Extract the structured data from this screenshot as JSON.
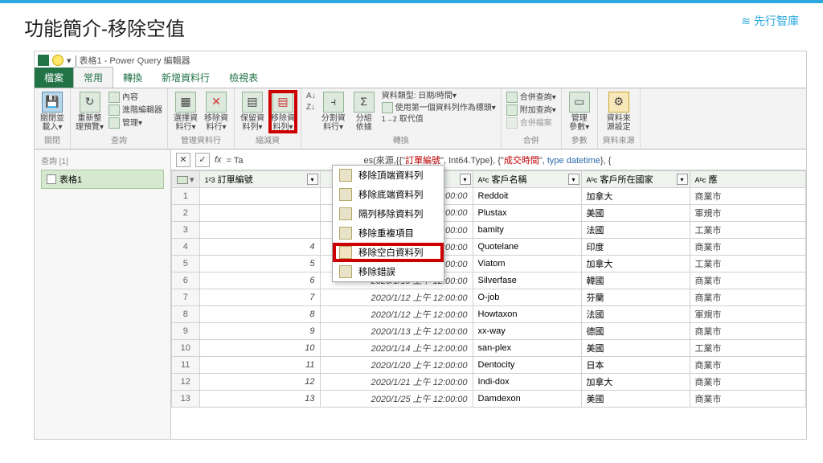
{
  "page": {
    "title": "功能簡介-移除空值",
    "brand": "先行智庫"
  },
  "window": {
    "title": "表格1 - Power Query 編輯器"
  },
  "tabs": {
    "file": "檔案",
    "home": "常用",
    "transform": "轉換",
    "addcol": "新增資料行",
    "view": "檢視表"
  },
  "ribbon": {
    "close": {
      "label": "關閉並\n載入▾",
      "group": "關閉"
    },
    "query": {
      "refresh": "重新整\n理預覽▾",
      "props": "內容",
      "adv": "進階編輯器",
      "manage": "管理▾",
      "group": "查詢"
    },
    "cols": {
      "choose": "選擇資\n料行▾",
      "remove": "移除資\n料行▾",
      "group": "管理資料行"
    },
    "rows": {
      "keep": "保留資\n料列▾",
      "removeRows": "移除資\n料列▾",
      "group": "縮減資"
    },
    "split": {
      "split": "分割資\n料行▾",
      "groupby": "分組\n依據",
      "datatype": "資料類型: 日期/時間▾",
      "firstrow": "使用第一個資料列作為標頭▾",
      "replace": "取代值",
      "group": "轉換"
    },
    "combine": {
      "merge": "合併查詢▾",
      "append": "附加查詢▾",
      "combinefile": "合併檔案",
      "group": "合併"
    },
    "params": {
      "label": "管理\n參數▾",
      "group": "參數"
    },
    "source": {
      "label": "資料來\n源設定",
      "group": "資料來源"
    }
  },
  "left": {
    "header": "查詢 [1]",
    "item": "表格1"
  },
  "formula": {
    "prefix": "= Ta",
    "rest": "es(來源,{{\"",
    "f1": "訂單編號",
    "mid1": "\", Int64.Type}, {\"",
    "f2": "成交時間",
    "mid2": "\", ",
    "kw": "type datetime",
    "end": "}, {"
  },
  "columns": {
    "c1": "訂單編號",
    "c2": "",
    "c3": "客戶名稱",
    "c4": "客戶所在國家",
    "c5": "應"
  },
  "rows": [
    {
      "n": 1,
      "id": "",
      "date": "",
      "time": "12:00:00",
      "cust": "Reddoit",
      "country": "加拿大",
      "last": "商業市"
    },
    {
      "n": 2,
      "id": "",
      "date": "",
      "time": "12:00:00",
      "cust": "Plustax",
      "country": "美國",
      "last": "軍規市"
    },
    {
      "n": 3,
      "id": "",
      "date": "",
      "time": "12:00:00",
      "cust": "bamity",
      "country": "法國",
      "last": "工業市"
    },
    {
      "n": 4,
      "id": 4,
      "date": "2020/1/9 上午 12:00:00",
      "time": "",
      "cust": "Quotelane",
      "country": "印度",
      "last": "商業市"
    },
    {
      "n": 5,
      "id": 5,
      "date": "2020/1/9 上午 12:00:00",
      "time": "",
      "cust": "Viatom",
      "country": "加拿大",
      "last": "工業市"
    },
    {
      "n": 6,
      "id": 6,
      "date": "2020/1/10 上午 12:00:00",
      "time": "",
      "cust": "Silverfase",
      "country": "韓國",
      "last": "商業市"
    },
    {
      "n": 7,
      "id": 7,
      "date": "2020/1/12 上午 12:00:00",
      "time": "",
      "cust": "O-job",
      "country": "芬蘭",
      "last": "商業市"
    },
    {
      "n": 8,
      "id": 8,
      "date": "2020/1/12 上午 12:00:00",
      "time": "",
      "cust": "Howtaxon",
      "country": "法國",
      "last": "軍規市"
    },
    {
      "n": 9,
      "id": 9,
      "date": "2020/1/13 上午 12:00:00",
      "time": "",
      "cust": "xx-way",
      "country": "德國",
      "last": "商業市"
    },
    {
      "n": 10,
      "id": 10,
      "date": "2020/1/14 上午 12:00:00",
      "time": "",
      "cust": "san-plex",
      "country": "美國",
      "last": "工業市"
    },
    {
      "n": 11,
      "id": 11,
      "date": "2020/1/20 上午 12:00:00",
      "time": "",
      "cust": "Dentocity",
      "country": "日本",
      "last": "商業市"
    },
    {
      "n": 12,
      "id": 12,
      "date": "2020/1/21 上午 12:00:00",
      "time": "",
      "cust": "Indi-dox",
      "country": "加拿大",
      "last": "商業市"
    },
    {
      "n": 13,
      "id": 13,
      "date": "2020/1/25 上午 12:00:00",
      "time": "",
      "cust": "Damdexon",
      "country": "美國",
      "last": "商業市"
    }
  ],
  "menu": {
    "top": "移除頂端資料列",
    "bottom": "移除底端資料列",
    "alt": "隔列移除資料列",
    "dup": "移除重複項目",
    "blank": "移除空白資料列",
    "err": "移除錯誤"
  },
  "partialDate": "2020/ 1/ 0 上午"
}
